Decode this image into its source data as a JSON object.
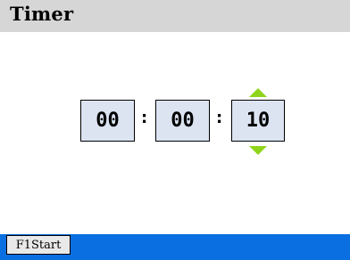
{
  "app": {
    "title": "Timer"
  },
  "timer": {
    "hours": "00",
    "minutes": "00",
    "seconds": "10",
    "separator": ":"
  },
  "softkeys": {
    "left_label": "F1Start"
  },
  "icons": {
    "up": "triangle-up-icon",
    "down": "triangle-down-icon"
  },
  "colors": {
    "title_bar": "#d6d6d6",
    "field_background": "#dce4f2",
    "arrow": "#8fd51c",
    "softkey_bar": "#0a6fe0"
  }
}
